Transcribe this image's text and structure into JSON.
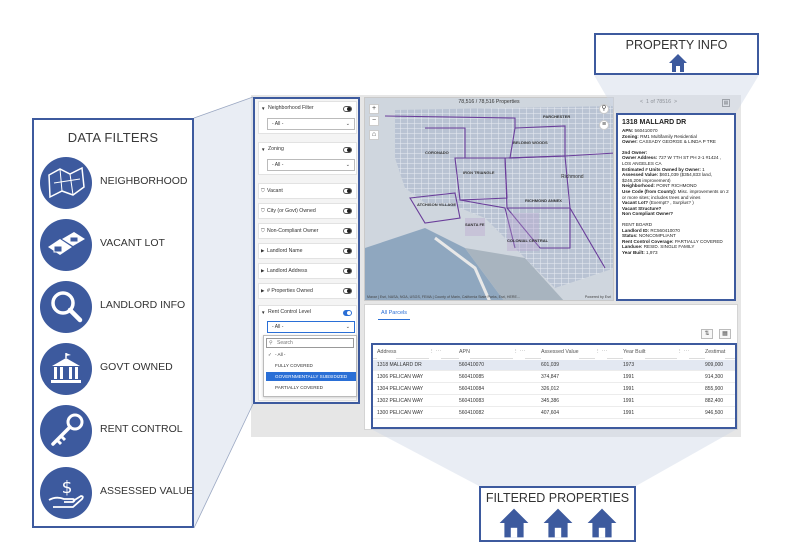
{
  "legend": {
    "title": "DATA FILTERS",
    "items": [
      {
        "label": "NEIGHBORHOOD",
        "icon": "neighborhood-map-icon"
      },
      {
        "label": "VACANT LOT",
        "icon": "vacant-lot-icon"
      },
      {
        "label": "LANDLORD INFO",
        "icon": "magnifier-icon"
      },
      {
        "label": "GOVT OWNED",
        "icon": "government-building-icon"
      },
      {
        "label": "RENT CONTROL",
        "icon": "key-icon"
      },
      {
        "label": "ASSESSED VALUE",
        "icon": "dollar-hand-icon"
      }
    ],
    "icon_color": "#3d5a9e"
  },
  "callouts": {
    "property_info": "PROPERTY INFO",
    "filtered_properties": "FILTERED PROPERTIES"
  },
  "filters": {
    "neighborhood": {
      "label": "Neighborhood Filter",
      "value": "- All -"
    },
    "zoning": {
      "label": "Zoning",
      "value": "- All -"
    },
    "vacant": "Vacant",
    "city_owned": "City (or Govt) Owned",
    "non_compliant": "Non-Compliant Owner",
    "landlord_name": "Landlord Name",
    "landlord_address": "Landlord Address",
    "properties_owned": "# Properties Owned",
    "rent_control": {
      "label": "Rent Control Level",
      "value": "- All -",
      "search_placeholder": "Search",
      "options": [
        "- All -",
        "FULLY COVERED",
        "GOVERNMENTALLY SUBSIDIZED",
        "PARTIALLY COVERED"
      ],
      "selected": "GOVERNMENTALLY SUBSIDIZED"
    }
  },
  "map": {
    "count": "78,516 / 78,516 Properties",
    "attribution": "Maxar | Esri, NASA, NGA, USGS, FEMA | County of Marin, California State Parks, Esri, HERE...",
    "powered": "Powered by Esri",
    "labels": [
      "IRON TRIANGLE",
      "ATCHISON VILLAGE",
      "SANTA FE",
      "RICHMOND ANNEX",
      "Richmond",
      "BELDING WOODS",
      "COLONIAL CENTRAL",
      "CORONADO",
      "PARCHESTER"
    ]
  },
  "info": {
    "pager": "1 of 78516",
    "address": "1318 MALLARD DR",
    "lines": [
      {
        "k": "APN:",
        "v": " 560410070"
      },
      {
        "k": "Zoning:",
        "v": " RM1 Multifamily Residential"
      },
      {
        "k": "Owner:",
        "v": " CASSADY GEORGE & LINDA P TRE"
      },
      {
        "gap": true
      },
      {
        "k": "2nd Owner:",
        "v": ""
      },
      {
        "k": "Owner Address:",
        "v": " 727 W 7TH ST PH 2-1 #1424 , LOS ANGELES CA"
      },
      {
        "k": "Estimated # Units Owned by Owner:",
        "v": " 1"
      },
      {
        "k": "Assessed Value:",
        "v": " $601,039 ($354,833 land, $246,206 improvement)"
      },
      {
        "k": "Neighborhood:",
        "v": " POINT RICHMOND"
      },
      {
        "k": "Use Code (from County):",
        "v": " Misc. improvements on 2 or more sites; includes trees and vines"
      },
      {
        "k": "Vacant Lot?",
        "v": " (Exempt? , Surplus? )"
      },
      {
        "k": "Vacant Structure?",
        "v": ""
      },
      {
        "k": "Non Compliant Owner?",
        "v": ""
      },
      {
        "gap": true
      },
      {
        "k": "",
        "v": "RENT BOARD"
      },
      {
        "k": "Landlord ID:",
        "v": " RC560410070"
      },
      {
        "k": "Status:",
        "v": " NONCOMPLIANT"
      },
      {
        "k": "Rent Control Coverage:",
        "v": " PARTIALLY COVERED"
      },
      {
        "k": "Landuse:",
        "v": " RESID. SINGLE FAMILY"
      },
      {
        "k": "Year Built:",
        "v": " 1,973"
      }
    ]
  },
  "table": {
    "tab": "All Parcels",
    "columns": [
      "Address",
      "APN",
      "Assessed Value",
      "Year Built",
      "Zestimat"
    ],
    "rows": [
      [
        "1318 MALLARD DR",
        "560410070",
        "601,039",
        "1973",
        "909,000"
      ],
      [
        "1306 PELICAN WAY",
        "560410085",
        "374,847",
        "1991",
        "914,300"
      ],
      [
        "1304 PELICAN WAY",
        "560410084",
        "326,012",
        "1991",
        "855,900"
      ],
      [
        "1302 PELICAN WAY",
        "560410083",
        "345,386",
        "1991",
        "882,400"
      ],
      [
        "1300 PELICAN WAY",
        "560410082",
        "407,604",
        "1991",
        "946,500"
      ]
    ]
  }
}
